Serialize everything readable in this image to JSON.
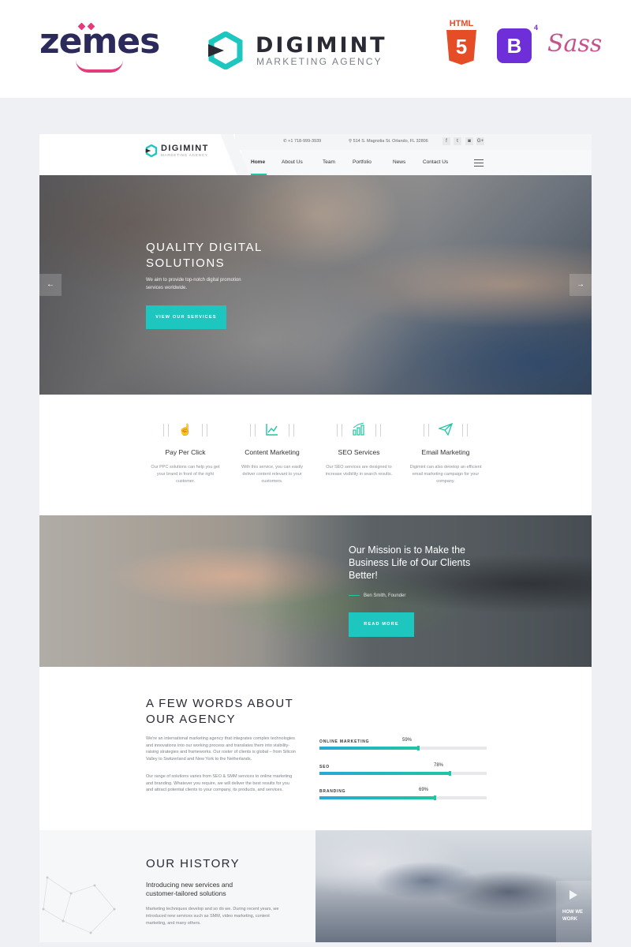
{
  "banner": {
    "zemes": {
      "label": "zemes"
    },
    "brand": {
      "name": "DIGIMINT",
      "tagline": "MARKETING AGENCY"
    },
    "tech": {
      "html5_label": "HTML",
      "html5_number": "5",
      "bootstrap_letter": "B",
      "bootstrap_version": "4",
      "sass_label": "Sass"
    }
  },
  "site": {
    "logo": {
      "name": "DIGIMINT",
      "tagline": "MARKETING AGENCY"
    },
    "topbar": {
      "phone": "+1 718-999-3939",
      "address": "514 S. Magnolia St. Orlando, FL 32806",
      "social": [
        "f",
        "t",
        "◙",
        "G+"
      ]
    },
    "nav": {
      "items": [
        "Home",
        "About Us",
        "Team",
        "Portfolio",
        "News",
        "Contact Us"
      ],
      "active": "Home"
    },
    "hero": {
      "title": "QUALITY DIGITAL SOLUTIONS",
      "text": "We aim to provide top-notch digital promotion services worldwide.",
      "button": "VIEW OUR SERVICES",
      "prev_icon": "arrow-left-icon",
      "next_icon": "arrow-right-icon"
    },
    "services": [
      {
        "title": "Pay Per Click",
        "icon": "pointer-click-icon",
        "desc": "Our PPC solutions can help you get your brand in front of the right customer."
      },
      {
        "title": "Content Marketing",
        "icon": "line-chart-icon",
        "desc": "With this service, you can easily deliver content relevant to your customers."
      },
      {
        "title": "SEO Services",
        "icon": "bar-chart-icon",
        "desc": "Our SEO services are designed to increase visibility in search results."
      },
      {
        "title": "Email Marketing",
        "icon": "paper-plane-icon",
        "desc": "Digimint can also develop an efficient email marketing campaign for your company."
      }
    ],
    "mission": {
      "title": "Our Mission is to Make the Business Life of Our Clients Better!",
      "author": "Ben Smith, Founder",
      "button": "READ MORE"
    },
    "about": {
      "title": "A FEW WORDS ABOUT OUR AGENCY",
      "p1": "We're an international marketing agency that integrates complex technologies and innovations into our working process and translates them into visibility-raising strategies and frameworks. Our roster of clients is global – from Silicon Valley to Switzerland and New York to the Netherlands.",
      "p2": "Our range of solutions varies from SEO & SMM services to online marketing and branding. Whatever you require, we will deliver the best results for you and attract potential clients to your company, its products, and services.",
      "skills": [
        {
          "name": "ONLINE MARKETING",
          "value": 59,
          "label": "59%"
        },
        {
          "name": "SEO",
          "value": 78,
          "label": "78%"
        },
        {
          "name": "BRANDING",
          "value": 69,
          "label": "69%"
        }
      ]
    },
    "history": {
      "title": "OUR HISTORY",
      "subtitle": "Introducing new services and customer-tailored solutions",
      "text": "Marketing techniques develop and so do we. During recent years, we introduced new services such as SMM, video marketing, content marketing, and many others.",
      "how_we_work": "HOW WE WORK"
    }
  },
  "colors": {
    "accent": "#1ec6a3",
    "button": "#1ec6c0",
    "zemes_navy": "#2b2a5a",
    "zemes_pink": "#e23c7b"
  }
}
